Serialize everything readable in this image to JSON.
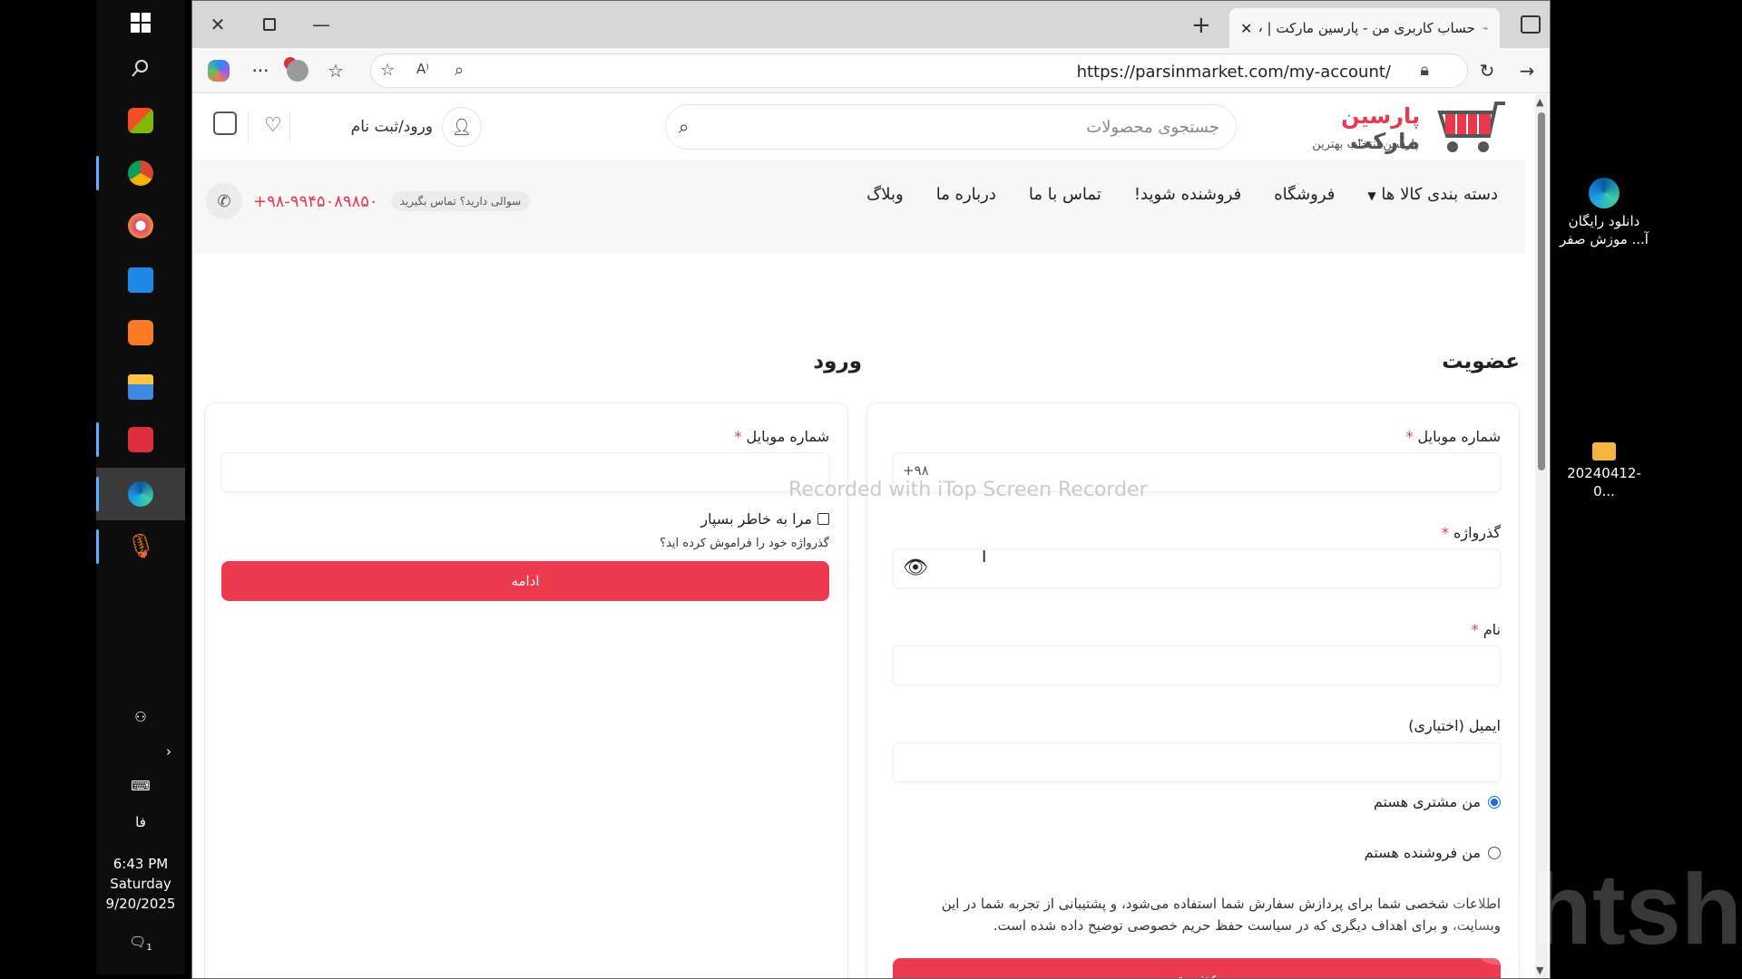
{
  "taskbar": {
    "lang": "فا",
    "time": "6:43 PM",
    "day": "Saturday",
    "date": "9/20/2025",
    "notif_count": "1",
    "icons": [
      "windows-icon",
      "search-icon",
      "store-icon",
      "chrome-icon",
      "media-player-icon",
      "mail-icon",
      "xampp-icon",
      "file-explorer-icon",
      "screen-recorder-icon",
      "edge-icon",
      "microphone-icon"
    ]
  },
  "browser": {
    "tab_title": "حساب کاربری من - پارسین مارکت | پ",
    "url": "https://parsinmarket.com/my-account/"
  },
  "site": {
    "logo_name": "پارسین",
    "logo_name2": "مارکت",
    "logo_tagline": "پارسین انتخاب بهترین",
    "search_placeholder": "جستجوی محصولات",
    "account_label": "ورود/ثبت نام",
    "menu": [
      "دسته بندی کالا ها",
      "فروشگاه",
      "فروشنده شوید!",
      "تماس با ما",
      "درباره ما",
      "وبلاگ"
    ],
    "question": "سوالی دارید؟ تماس بگیرید",
    "phone": "+۹۸-۹۹۴۵۰۸۹۸۵۰"
  },
  "register": {
    "title": "عضویت",
    "mobile_label": "شماره موبایل",
    "mobile_prefix": "+۹۸",
    "password_label": "گذرواژه",
    "name_label": "نام",
    "email_label": "ایمیل (اختیاری)",
    "radio_customer": "من مشتری هستم",
    "radio_seller": "من فروشنده هستم",
    "privacy": "اطلاعات شخصی شما برای پردازش سفارش شما استفاده می‌شود، و پشتیبانی از تجربه شما در این وبسایت، و برای اهداف دیگری که در سیاست حفظ حریم خصوصی توضیح داده شده است.",
    "submit": "عضویت"
  },
  "login": {
    "title": "ورود",
    "mobile_label": "شماره موبایل",
    "remember": "مرا به خاطر بسپار",
    "forgot": "گذرواژه خود را فراموش کرده اید؟",
    "submit": "ادامه"
  },
  "required_mark": "*",
  "watermark": "Recorded with iTop Screen Recorder",
  "desktop": {
    "item1": "دانلود رایگان آ... موزش صفر",
    "item2": "20240412-0...",
    "lightshot": "ightshot"
  },
  "colors": {
    "accent": "#ec3a4e",
    "radio": "#1a6fe0"
  }
}
